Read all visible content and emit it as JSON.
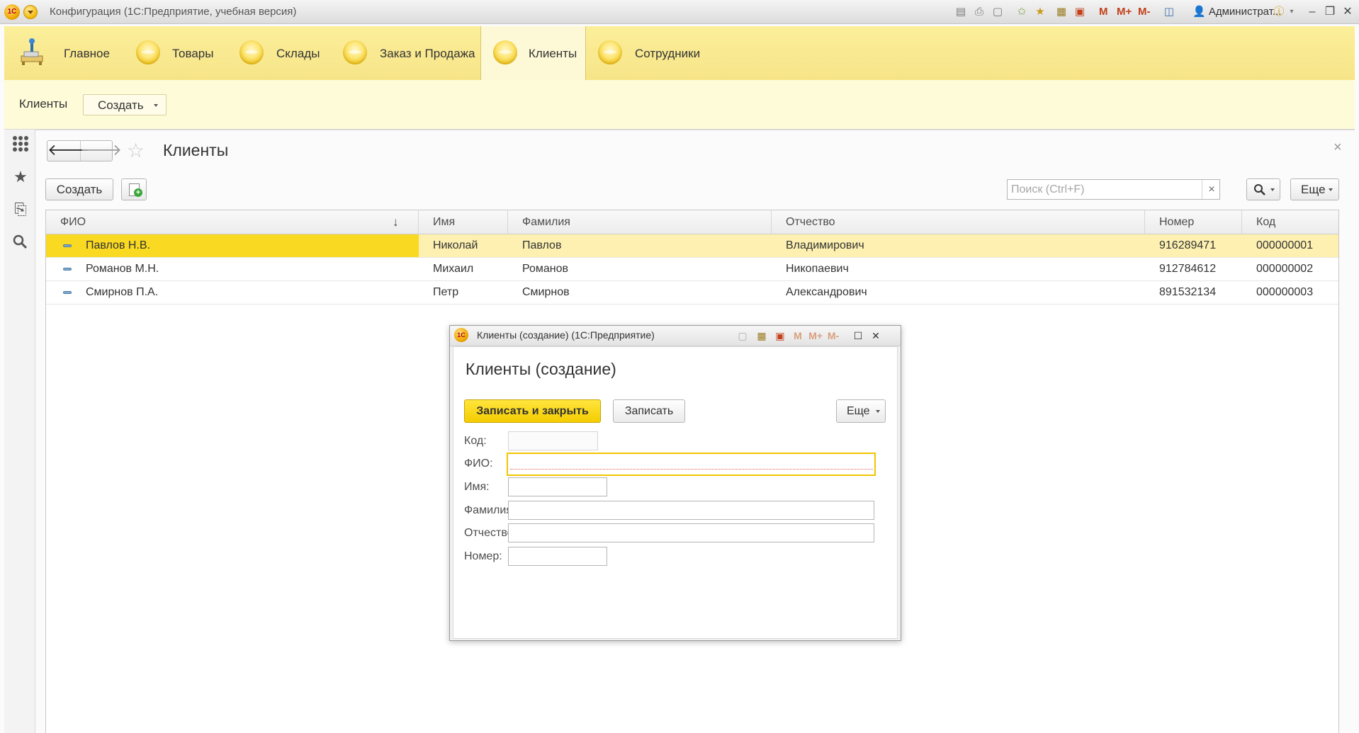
{
  "titlebar": {
    "logo_text": "1С",
    "title": "Конфигурация  (1С:Предприятие, учебная версия)",
    "m_buttons": [
      "M",
      "M+",
      "M-"
    ],
    "user": "Администрат..."
  },
  "sections": [
    {
      "label": "Главное"
    },
    {
      "label": "Товары"
    },
    {
      "label": "Склады"
    },
    {
      "label": "Заказ и Продажа"
    },
    {
      "label": "Клиенты",
      "active": true
    },
    {
      "label": "Сотрудники"
    }
  ],
  "function_panel": {
    "label": "Клиенты",
    "create_label": "Создать"
  },
  "form": {
    "title": "Клиенты",
    "create_label": "Создать",
    "search_placeholder": "Поиск (Ctrl+F)",
    "more_label": "Еще"
  },
  "table": {
    "columns": [
      "ФИО",
      "Имя",
      "Фамилия",
      "Отчество",
      "Номер",
      "Код"
    ],
    "sort_indicator": "↓",
    "rows": [
      {
        "fio": "Павлов Н.В.",
        "name": "Николай",
        "surname": "Павлов",
        "patronymic": "Владимирович",
        "number": "916289471",
        "code": "000000001",
        "current": true
      },
      {
        "fio": "Романов М.Н.",
        "name": "Михаил",
        "surname": "Романов",
        "patronymic": "Никопаевич",
        "number": "912784612",
        "code": "000000002"
      },
      {
        "fio": "Смирнов П.А.",
        "name": "Петр",
        "surname": "Смирнов",
        "patronymic": "Александрович",
        "number": "891532134",
        "code": "000000003"
      }
    ]
  },
  "dialog": {
    "window_title": "Клиенты (создание)  (1С:Предприятие)",
    "heading": "Клиенты (создание)",
    "m_buttons": [
      "M",
      "M+",
      "M-"
    ],
    "save_close_label": "Записать и закрыть",
    "save_label": "Записать",
    "more_label": "Еще",
    "fields": {
      "code": {
        "label": "Код:",
        "value": ""
      },
      "fio": {
        "label": "ФИО:",
        "value": ""
      },
      "name": {
        "label": "Имя:",
        "value": ""
      },
      "surname": {
        "label": "Фамилия:",
        "value": ""
      },
      "patronymic": {
        "label": "Отчество:",
        "value": ""
      },
      "number": {
        "label": "Номер:",
        "value": ""
      }
    }
  },
  "colors": {
    "section_bar": "#f7e488",
    "current_row": "#f9d921",
    "primary_button": "#f4cc00"
  }
}
